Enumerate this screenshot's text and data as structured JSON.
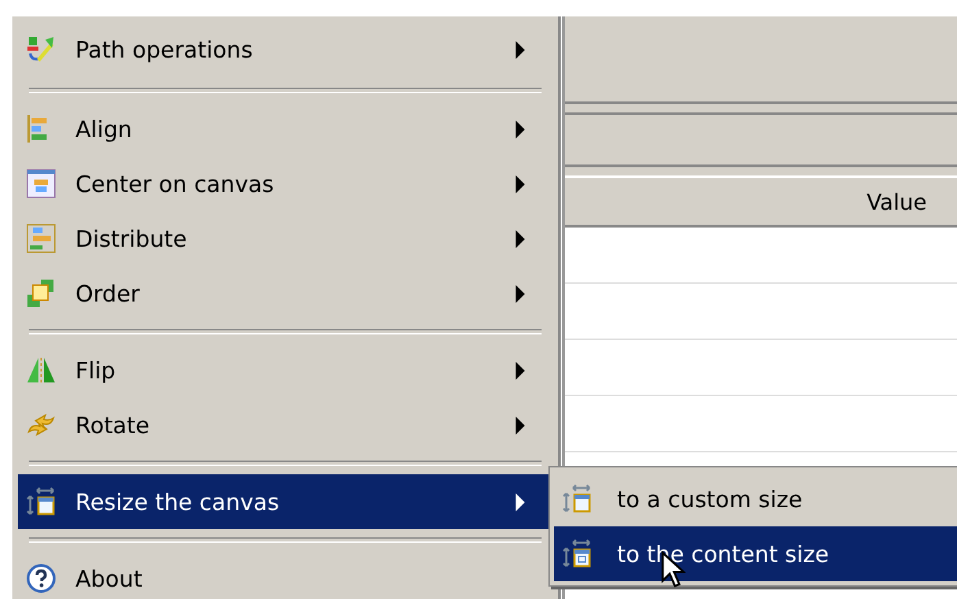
{
  "panel": {
    "table": {
      "columns": [
        "Value"
      ]
    }
  },
  "menu": {
    "items": [
      {
        "kind": "item",
        "label": "Path operations",
        "submenu": true,
        "selected": false
      },
      {
        "kind": "separator"
      },
      {
        "kind": "item",
        "label": "Align",
        "submenu": true,
        "selected": false
      },
      {
        "kind": "item",
        "label": "Center on canvas",
        "submenu": true,
        "selected": false
      },
      {
        "kind": "item",
        "label": "Distribute",
        "submenu": true,
        "selected": false
      },
      {
        "kind": "item",
        "label": "Order",
        "submenu": true,
        "selected": false
      },
      {
        "kind": "separator"
      },
      {
        "kind": "item",
        "label": "Flip",
        "submenu": true,
        "selected": false
      },
      {
        "kind": "item",
        "label": "Rotate",
        "submenu": true,
        "selected": false
      },
      {
        "kind": "separator"
      },
      {
        "kind": "item",
        "label": "Resize the canvas",
        "submenu": true,
        "selected": true
      },
      {
        "kind": "separator"
      },
      {
        "kind": "item",
        "label": "About",
        "submenu": false,
        "selected": false
      }
    ]
  },
  "submenu": {
    "items": [
      {
        "label": "to a custom size",
        "selected": false
      },
      {
        "label": "to the content size",
        "selected": true
      }
    ]
  }
}
